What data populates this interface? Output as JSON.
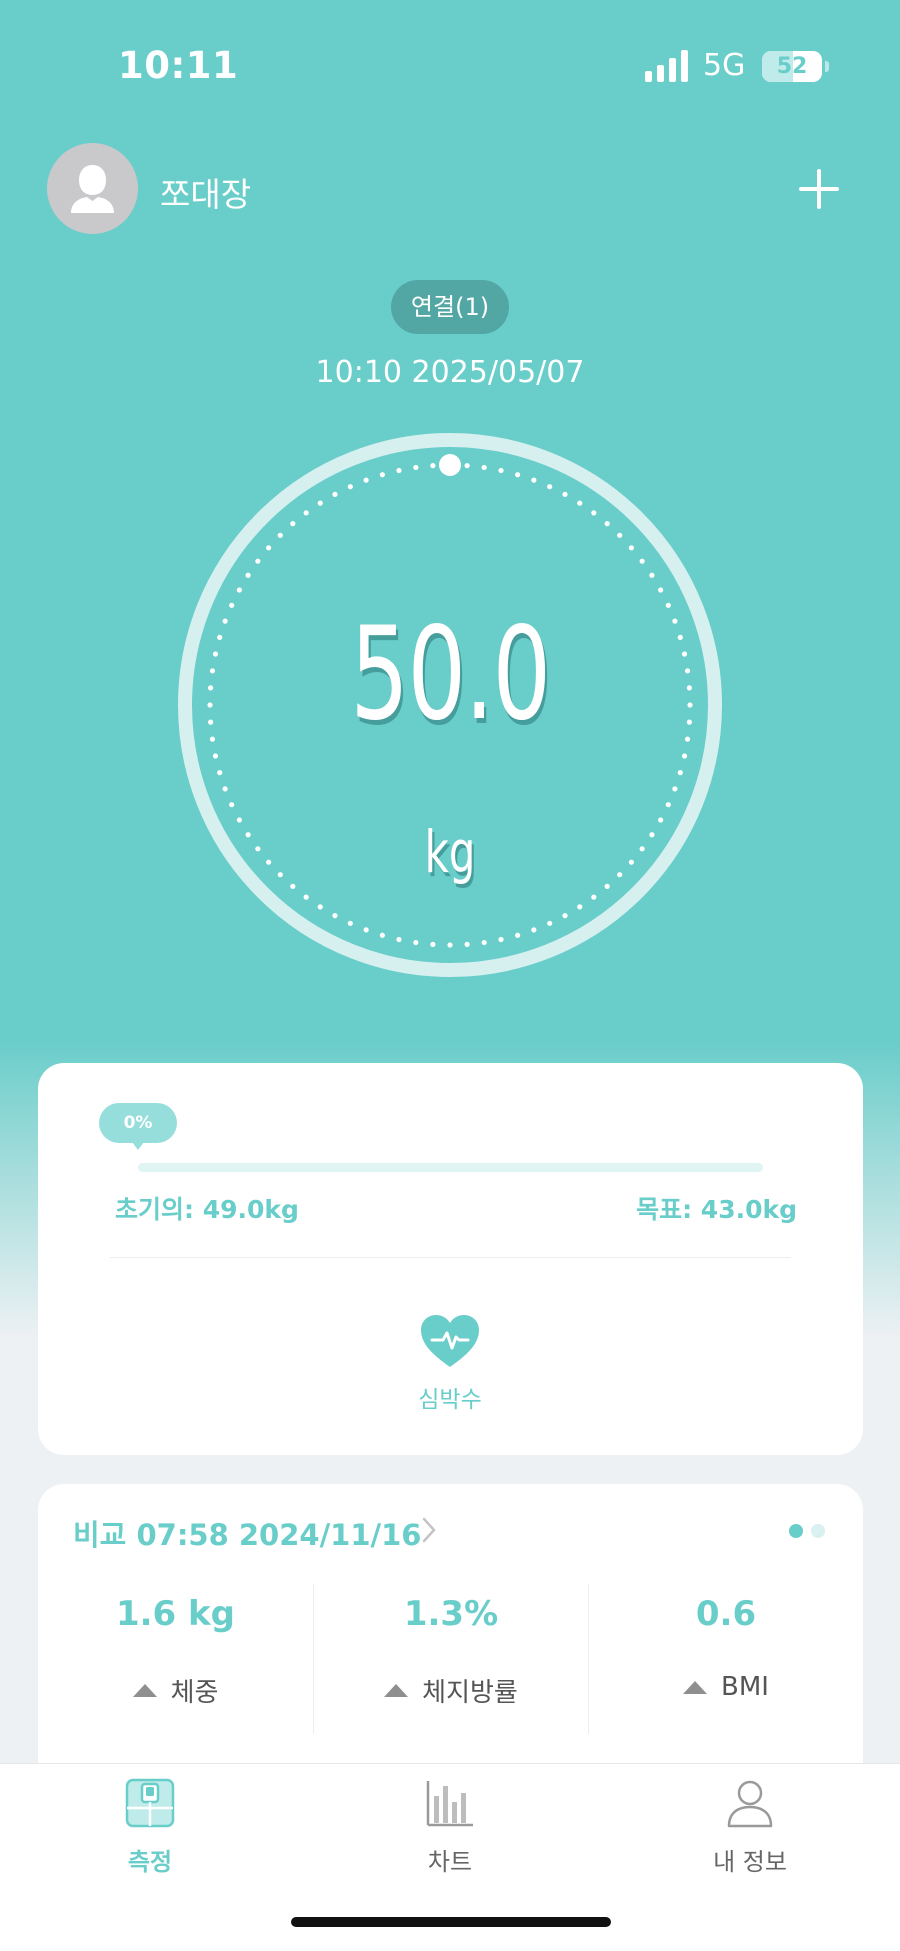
{
  "status_bar": {
    "time": "10:11",
    "network": "5G",
    "battery_percent": 52,
    "battery_label": "52"
  },
  "header": {
    "user_name": "쪼대장",
    "avatar_icon": "person-silhouette-icon",
    "add_icon": "plus-icon"
  },
  "connection": {
    "label": "연결(1)"
  },
  "measurement": {
    "datetime": "10:10 2025/05/07",
    "weight": "50.0",
    "unit": "kg"
  },
  "goal": {
    "progress_label": "0%",
    "progress_fraction": 0,
    "initial_label": "초기의: 49.0kg",
    "target_label": "목표: 43.0kg"
  },
  "heart_rate": {
    "label": "심박수",
    "icon": "heart-pulse-icon"
  },
  "compare": {
    "title": "비교 07:58 2024/11/16",
    "page_count": 2,
    "active_page": 0,
    "stats": [
      {
        "value": "1.6 kg",
        "label": "체중",
        "trend": "up"
      },
      {
        "value": "1.3%",
        "label": "체지방률",
        "trend": "up"
      },
      {
        "value": "0.6",
        "label": "BMI",
        "trend": "up"
      }
    ]
  },
  "tabs": [
    {
      "label": "측정",
      "icon": "scale-icon",
      "active": true
    },
    {
      "label": "차트",
      "icon": "bar-chart-icon",
      "active": false
    },
    {
      "label": "내 정보",
      "icon": "profile-icon",
      "active": false
    }
  ],
  "colors": {
    "accent": "#69cdca",
    "pill": "#52a7a4",
    "ring": "#d6f0f0"
  }
}
